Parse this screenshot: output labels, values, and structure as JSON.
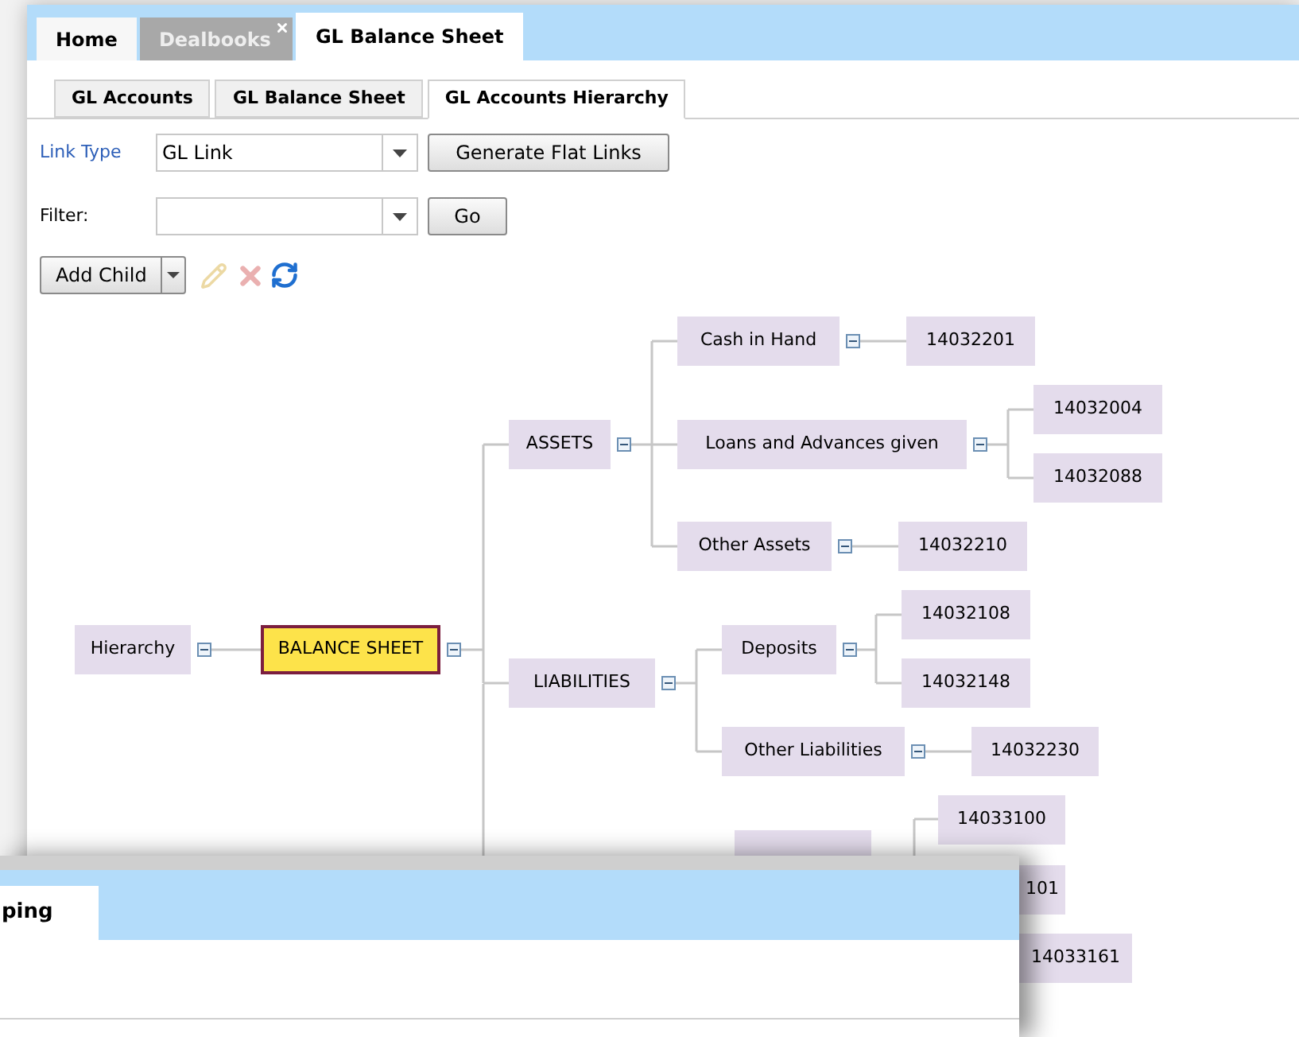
{
  "window_tabs": [
    {
      "label": "Home",
      "selected": false,
      "hovered": false,
      "closable": false
    },
    {
      "label": "Dealbooks",
      "selected": false,
      "hovered": true,
      "closable": true
    },
    {
      "label": "GL Balance Sheet",
      "selected": true,
      "hovered": false,
      "closable": false
    }
  ],
  "sub_tabs": [
    {
      "label": "GL Accounts",
      "selected": false
    },
    {
      "label": "GL Balance Sheet",
      "selected": false
    },
    {
      "label": "GL Accounts Hierarchy",
      "selected": true
    }
  ],
  "link_type": {
    "label": "Link Type",
    "value": "GL Link",
    "button": "Generate Flat Links"
  },
  "filter": {
    "label": "Filter:",
    "button": "Go"
  },
  "toolbar": {
    "add_button": "Add Child",
    "edit_disabled": true,
    "delete_disabled": true
  },
  "tree": {
    "label": "Hierarchy",
    "expanded": true,
    "selected": false,
    "children": [
      {
        "label": "BALANCE SHEET",
        "expanded": true,
        "selected": true,
        "children": [
          {
            "label": "ASSETS",
            "expanded": true,
            "selected": false,
            "children": [
              {
                "label": "Cash in Hand",
                "expanded": true,
                "selected": false,
                "children": [
                  {
                    "label": "14032201",
                    "selected": false
                  }
                ]
              },
              {
                "label": "Loans and Advances given",
                "expanded": true,
                "selected": false,
                "children": [
                  {
                    "label": "14032004",
                    "selected": false
                  },
                  {
                    "label": "14032088",
                    "selected": false
                  }
                ]
              },
              {
                "label": "Other Assets",
                "expanded": true,
                "selected": false,
                "children": [
                  {
                    "label": "14032210",
                    "selected": false
                  }
                ]
              }
            ]
          },
          {
            "label": "LIABILITIES",
            "expanded": true,
            "selected": false,
            "children": [
              {
                "label": "Deposits",
                "expanded": true,
                "selected": false,
                "children": [
                  {
                    "label": "14032108",
                    "selected": false
                  },
                  {
                    "label": "14032148",
                    "selected": false
                  }
                ]
              },
              {
                "label": "Other Liabilities",
                "expanded": true,
                "selected": false,
                "children": [
                  {
                    "label": "14032230",
                    "selected": false
                  }
                ]
              }
            ]
          }
        ]
      }
    ]
  },
  "partial_nodes": [
    {
      "label": "14033100"
    },
    {
      "label": "101"
    },
    {
      "label": "14033161"
    }
  ],
  "overlay_window": {
    "tab": "ping"
  }
}
